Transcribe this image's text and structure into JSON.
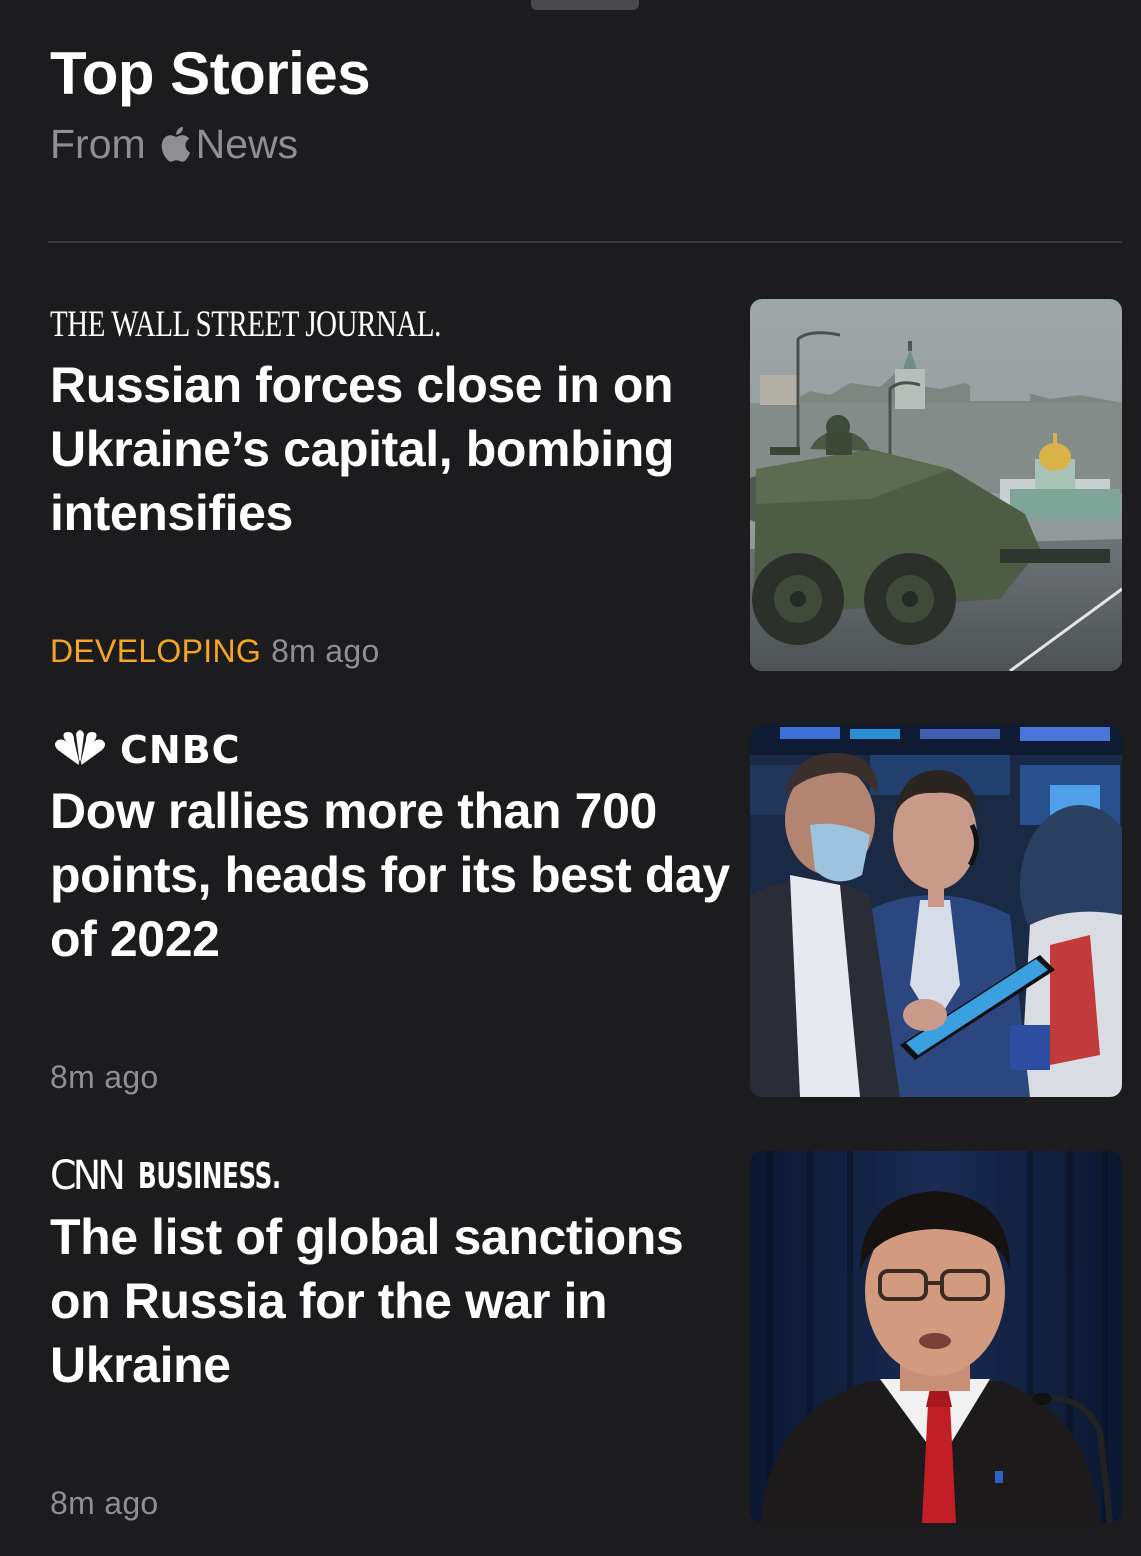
{
  "header": {
    "title": "Top Stories",
    "subtitle_prefix": "From",
    "subtitle_brand": "News"
  },
  "colors": {
    "background": "#1c1c1e",
    "developing_tag": "#f5a623",
    "secondary_text": "#8e8e93"
  },
  "stories": [
    {
      "source": "THE WALL STREET JOURNAL.",
      "headline": "Russian forces close in on Ukraine’s capital, bombing intensifies",
      "tag": "DEVELOPING",
      "time": "8m ago",
      "image": "armored-vehicle-photo"
    },
    {
      "source": "CNBC",
      "headline": "Dow rallies more than 700 points, heads for its best day of 2022",
      "tag": "",
      "time": "8m ago",
      "image": "stock-traders-photo"
    },
    {
      "source_mark": "CNN",
      "source": "BUSINESS.",
      "headline": "The list of global sanctions on Russia for the war in Ukraine",
      "tag": "",
      "time": "8m ago",
      "image": "politician-speaking-photo"
    }
  ]
}
